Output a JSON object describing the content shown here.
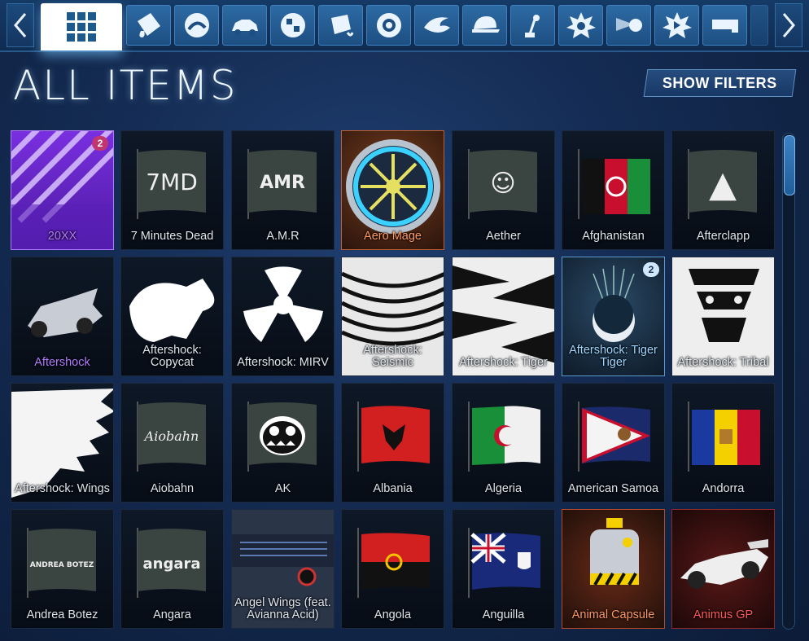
{
  "title": "ALL ITEMS",
  "filters_label": "SHOW FILTERS",
  "tabs": [
    {
      "icon": "all-items-grid-icon"
    },
    {
      "icon": "paint-icon"
    },
    {
      "icon": "banner-icon"
    },
    {
      "icon": "car-body-icon"
    },
    {
      "icon": "decal-icon"
    },
    {
      "icon": "paint-finish-icon"
    },
    {
      "icon": "wheel-icon"
    },
    {
      "icon": "boost-icon"
    },
    {
      "icon": "topper-icon"
    },
    {
      "icon": "antenna-icon"
    },
    {
      "icon": "goal-explosion-icon"
    },
    {
      "icon": "trail-icon"
    },
    {
      "icon": "engine-audio-icon"
    },
    {
      "icon": "player-title-icon"
    }
  ],
  "items": [
    {
      "name": "20XX",
      "rarity": "purple",
      "badge": "2"
    },
    {
      "name": "7 Minutes Dead",
      "flag": "7MD"
    },
    {
      "name": "A.M.R",
      "flag": "AMR"
    },
    {
      "name": "Aero Mage",
      "rarity": "orange"
    },
    {
      "name": "Aether",
      "flag": "☺"
    },
    {
      "name": "Afghanistan"
    },
    {
      "name": "Afterclapp",
      "flag": "▲"
    },
    {
      "name": "Aftershock",
      "rarity": "purple-text"
    },
    {
      "name": "Aftershock: Copycat"
    },
    {
      "name": "Aftershock: MIRV"
    },
    {
      "name": "Aftershock: Seismic"
    },
    {
      "name": "Aftershock: Tiger"
    },
    {
      "name": "Aftershock: Tiger Tiger",
      "rarity": "blue",
      "badge": "2"
    },
    {
      "name": "Aftershock: Tribal"
    },
    {
      "name": "Aftershock: Wings"
    },
    {
      "name": "Aiobahn",
      "flag": "Aiobahn"
    },
    {
      "name": "AK"
    },
    {
      "name": "Albania"
    },
    {
      "name": "Algeria"
    },
    {
      "name": "American Samoa"
    },
    {
      "name": "Andorra"
    },
    {
      "name": "Andrea Botez",
      "flag": "ANDREA BOTEZ"
    },
    {
      "name": "Angara",
      "flag": "angara"
    },
    {
      "name": "Angel Wings (feat. Avianna Acid)"
    },
    {
      "name": "Angola"
    },
    {
      "name": "Anguilla"
    },
    {
      "name": "Animal Capsule",
      "rarity": "orange"
    },
    {
      "name": "Animus GP",
      "rarity": "red"
    }
  ],
  "colors": {
    "accent": "#2d6aa3",
    "purple": "#7a2fe0",
    "orange": "#ff9a62",
    "red": "#ff5a5a"
  }
}
